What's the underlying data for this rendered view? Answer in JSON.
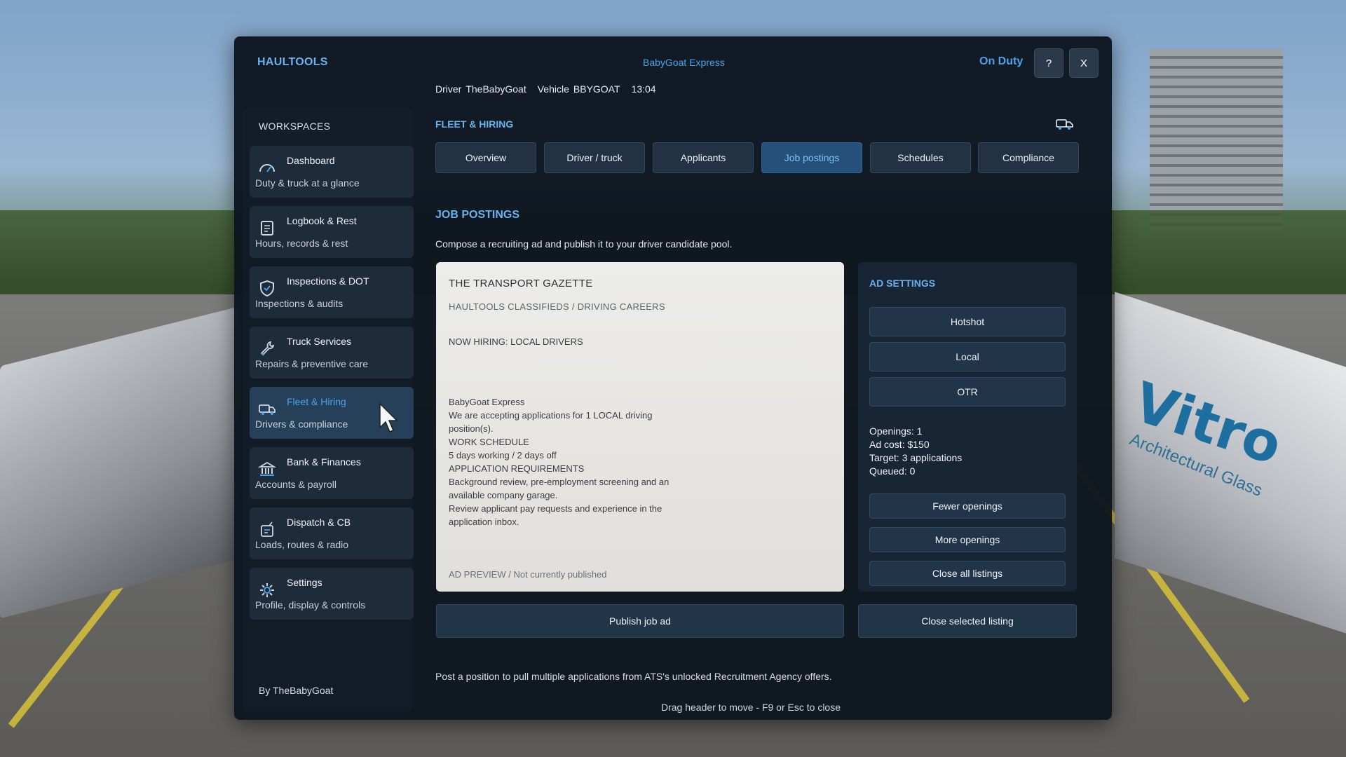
{
  "header": {
    "app_title": "HAULTOOLS",
    "company": "BabyGoat Express",
    "status": "On Duty",
    "help_label": "?",
    "close_label": "X",
    "driver_label": "Driver",
    "driver_value": "TheBabyGoat",
    "vehicle_label": "Vehicle",
    "vehicle_value": "BBYGOAT",
    "time": "13:04"
  },
  "sidebar": {
    "title": "WORKSPACES",
    "items": [
      {
        "title": "Dashboard",
        "subtitle": "Duty & truck at a glance",
        "icon": "gauge-icon"
      },
      {
        "title": "Logbook & Rest",
        "subtitle": "Hours, records & rest",
        "icon": "logbook-icon"
      },
      {
        "title": "Inspections & DOT",
        "subtitle": "Inspections & audits",
        "icon": "shield-check-icon"
      },
      {
        "title": "Truck Services",
        "subtitle": "Repairs & preventive care",
        "icon": "wrench-icon"
      },
      {
        "title": "Fleet & Hiring",
        "subtitle": "Drivers & compliance",
        "icon": "truck-icon"
      },
      {
        "title": "Bank & Finances",
        "subtitle": "Accounts & payroll",
        "icon": "bank-icon"
      },
      {
        "title": "Dispatch & CB",
        "subtitle": "Loads, routes & radio",
        "icon": "radio-icon"
      },
      {
        "title": "Settings",
        "subtitle": "Profile, display & controls",
        "icon": "gear-icon"
      }
    ],
    "active_index": 4,
    "footer": "By TheBabyGoat"
  },
  "main": {
    "section": "FLEET & HIRING",
    "tabs": [
      "Overview",
      "Driver / truck",
      "Applicants",
      "Job postings",
      "Schedules",
      "Compliance"
    ],
    "active_tab": "Job postings",
    "title": "JOB POSTINGS",
    "description": "Compose a recruiting ad and publish it to your driver candidate pool."
  },
  "ad_preview": {
    "paper_name": "THE TRANSPORT GAZETTE",
    "section": "HAULTOOLS CLASSIFIEDS / DRIVING CAREERS",
    "headline": "NOW HIRING: LOCAL DRIVERS",
    "body_lines": [
      "BabyGoat Express",
      "We are accepting applications for 1 LOCAL driving",
      "position(s).",
      "WORK SCHEDULE",
      "5 days working / 2 days off",
      "APPLICATION REQUIREMENTS",
      "Background review, pre-employment screening and an",
      "available company garage.",
      "Review applicant pay requests and experience in the",
      "application inbox."
    ],
    "footer": "AD PREVIEW / Not currently published"
  },
  "ad_settings": {
    "title": "AD SETTINGS",
    "types": [
      "Hotshot",
      "Local",
      "OTR"
    ],
    "openings": "Openings: 1",
    "ad_cost": "Ad cost: $150",
    "target": "Target: 3 applications",
    "queued": "Queued: 0",
    "fewer_label": "Fewer openings",
    "more_label": "More openings",
    "close_all_label": "Close all listings"
  },
  "actions": {
    "publish_label": "Publish job ad",
    "close_selected_label": "Close selected listing"
  },
  "footer": {
    "note": "Post a position to pull multiple applications from ATS's unlocked Recruitment Agency offers.",
    "hint": "Drag header to move - F9 or Esc to close"
  },
  "colors": {
    "accent": "#4aa3ea",
    "panel_bg": "#0d161f",
    "active_tab_bg": "#24507a"
  }
}
